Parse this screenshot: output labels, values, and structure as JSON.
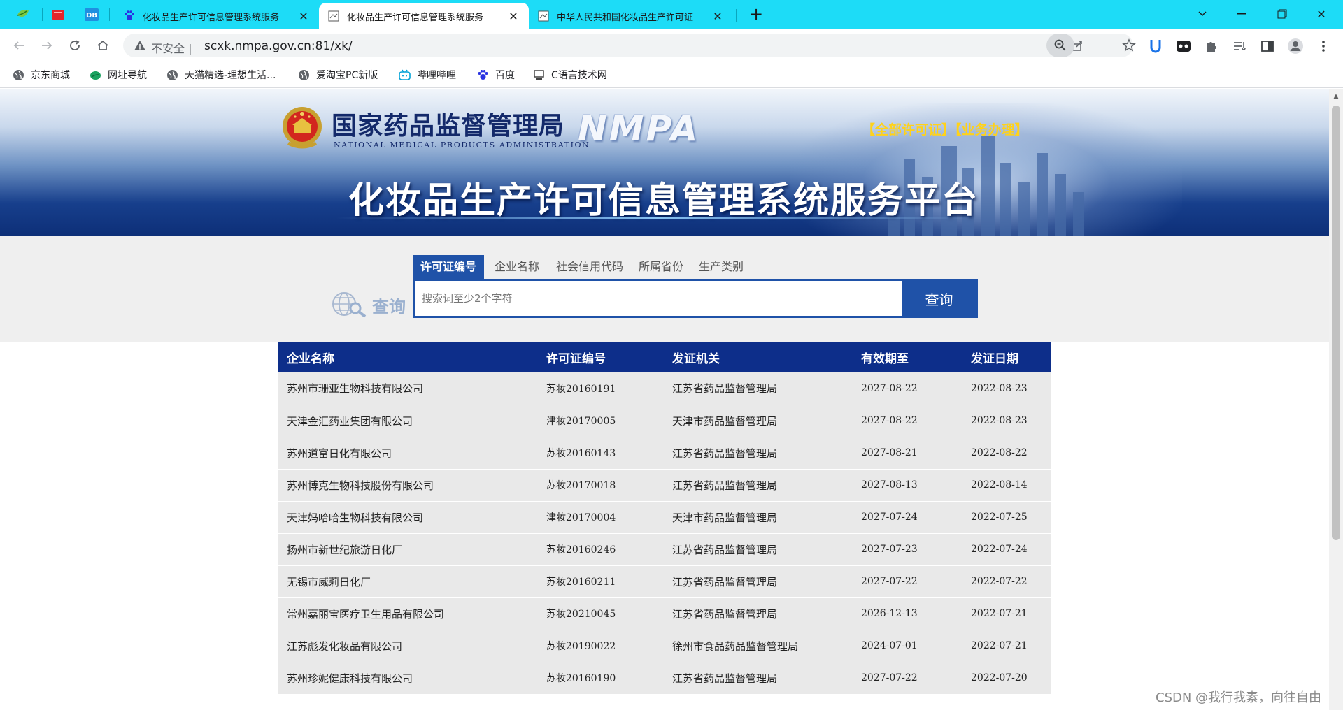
{
  "browser": {
    "tabs": [
      {
        "title": "化妆品生产许可信息管理系统服务",
        "active": false
      },
      {
        "title": "化妆品生产许可信息管理系统服务",
        "active": true
      },
      {
        "title": "中华人民共和国化妆品生产许可证",
        "active": false
      }
    ],
    "address": {
      "security_label": "不安全",
      "url": "scxk.nmpa.gov.cn:81/xk/"
    },
    "bookmarks": [
      {
        "label": "京东商城",
        "icon": "globe-icon"
      },
      {
        "label": "网址导航",
        "icon": "leaf-icon"
      },
      {
        "label": "天猫精选-理想生活...",
        "icon": "globe-icon"
      },
      {
        "label": "爱淘宝PC新版",
        "icon": "globe-icon"
      },
      {
        "label": "哔哩哔哩",
        "icon": "bilibili-icon"
      },
      {
        "label": "百度",
        "icon": "baidu-paw-icon"
      },
      {
        "label": "C语言技术网",
        "icon": "computer-icon"
      }
    ]
  },
  "header": {
    "agency_cn": "国家药品监督管理局",
    "agency_en": "NATIONAL MEDICAL PRODUCTS ADMINISTRATION",
    "logo_text": "NMPA",
    "links": "【全部许可证】【业务办理】",
    "platform_title": "化妆品生产许可信息管理系统服务平台"
  },
  "search": {
    "label": "查询",
    "tabs": [
      "许可证编号",
      "企业名称",
      "社会信用代码",
      "所属省份",
      "生产类别"
    ],
    "placeholder": "搜索词至少2个字符",
    "button": "查询"
  },
  "table": {
    "columns": [
      "企业名称",
      "许可证编号",
      "发证机关",
      "有效期至",
      "发证日期"
    ],
    "rows": [
      [
        "苏州市珊亚生物科技有限公司",
        "苏妆20160191",
        "江苏省药品监督管理局",
        "2027-08-22",
        "2022-08-23"
      ],
      [
        "天津金汇药业集团有限公司",
        "津妆20170005",
        "天津市药品监督管理局",
        "2027-08-22",
        "2022-08-23"
      ],
      [
        "苏州道富日化有限公司",
        "苏妆20160143",
        "江苏省药品监督管理局",
        "2027-08-21",
        "2022-08-22"
      ],
      [
        "苏州博克生物科技股份有限公司",
        "苏妆20170018",
        "江苏省药品监督管理局",
        "2027-08-13",
        "2022-08-14"
      ],
      [
        "天津妈哈哈生物科技有限公司",
        "津妆20170004",
        "天津市药品监督管理局",
        "2027-07-24",
        "2022-07-25"
      ],
      [
        "扬州市新世纪旅游日化厂",
        "苏妆20160246",
        "江苏省药品监督管理局",
        "2027-07-23",
        "2022-07-24"
      ],
      [
        "无锡市威莉日化厂",
        "苏妆20160211",
        "江苏省药品监督管理局",
        "2027-07-22",
        "2022-07-22"
      ],
      [
        "常州嘉丽宝医疗卫生用品有限公司",
        "苏妆20210045",
        "江苏省药品监督管理局",
        "2026-12-13",
        "2022-07-21"
      ],
      [
        "江苏彪发化妆品有限公司",
        "苏妆20190022",
        "徐州市食品药品监督管理局",
        "2024-07-01",
        "2022-07-21"
      ],
      [
        "苏州珍妮健康科技有限公司",
        "苏妆20160190",
        "江苏省药品监督管理局",
        "2027-07-22",
        "2022-07-20"
      ]
    ]
  },
  "watermark": "CSDN @我行我素，向往自由"
}
